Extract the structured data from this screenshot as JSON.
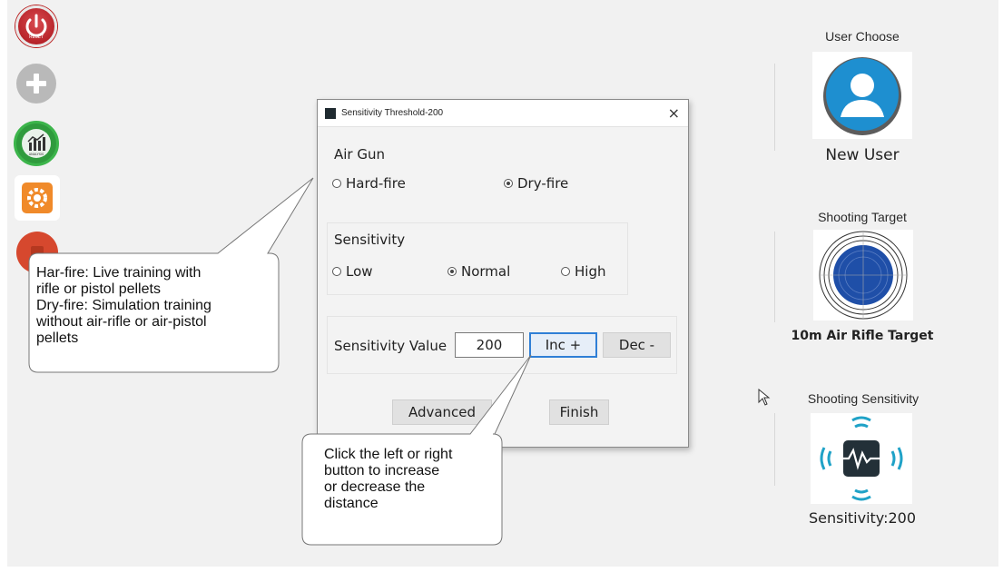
{
  "sidebar": {
    "reset_label": "RESET",
    "analysis_label": "ANALYSIS",
    "icons": [
      "power-icon",
      "plus-icon",
      "bar-chart-icon",
      "gear-icon",
      "exit-icon"
    ]
  },
  "right_panel": {
    "user_title": "User Choose",
    "user_name": "New User",
    "target_title": "Shooting Target",
    "target_name": "10m Air Rifle Target",
    "sensitivity_title": "Shooting Sensitivity",
    "sensitivity_value": "Sensitivity:200"
  },
  "dialog": {
    "title": "Sensitivity Threshold-200",
    "close_glyph": "×",
    "air_gun_label": "Air Gun",
    "air_gun_options": [
      {
        "label": "Hard-fire",
        "selected": false
      },
      {
        "label": "Dry-fire",
        "selected": true
      }
    ],
    "sensitivity_label": "Sensitivity",
    "sensitivity_options": [
      {
        "label": "Low",
        "selected": false
      },
      {
        "label": "Normal",
        "selected": true
      },
      {
        "label": "High",
        "selected": false
      }
    ],
    "value_label": "Sensitivity Value",
    "value": "200",
    "inc_label": "Inc +",
    "dec_label": "Dec -",
    "advanced_label": "Advanced",
    "finish_label": "Finish"
  },
  "callouts": {
    "fire_modes": [
      "Har-fire: Live training with",
      "rifle or pistol pellets",
      "Dry-fire: Simulation training",
      "without air-rifle or air-pistol",
      "pellets"
    ],
    "buttons_hint": [
      "Click the left or right",
      "button to increase",
      "or decrease the",
      "distance"
    ]
  },
  "colors": {
    "accent_blue": "#2f7fd6",
    "target_blue": "#1f4fa8",
    "sensitivity_teal": "#1fa2c7",
    "user_blue": "#1e8fd0"
  }
}
